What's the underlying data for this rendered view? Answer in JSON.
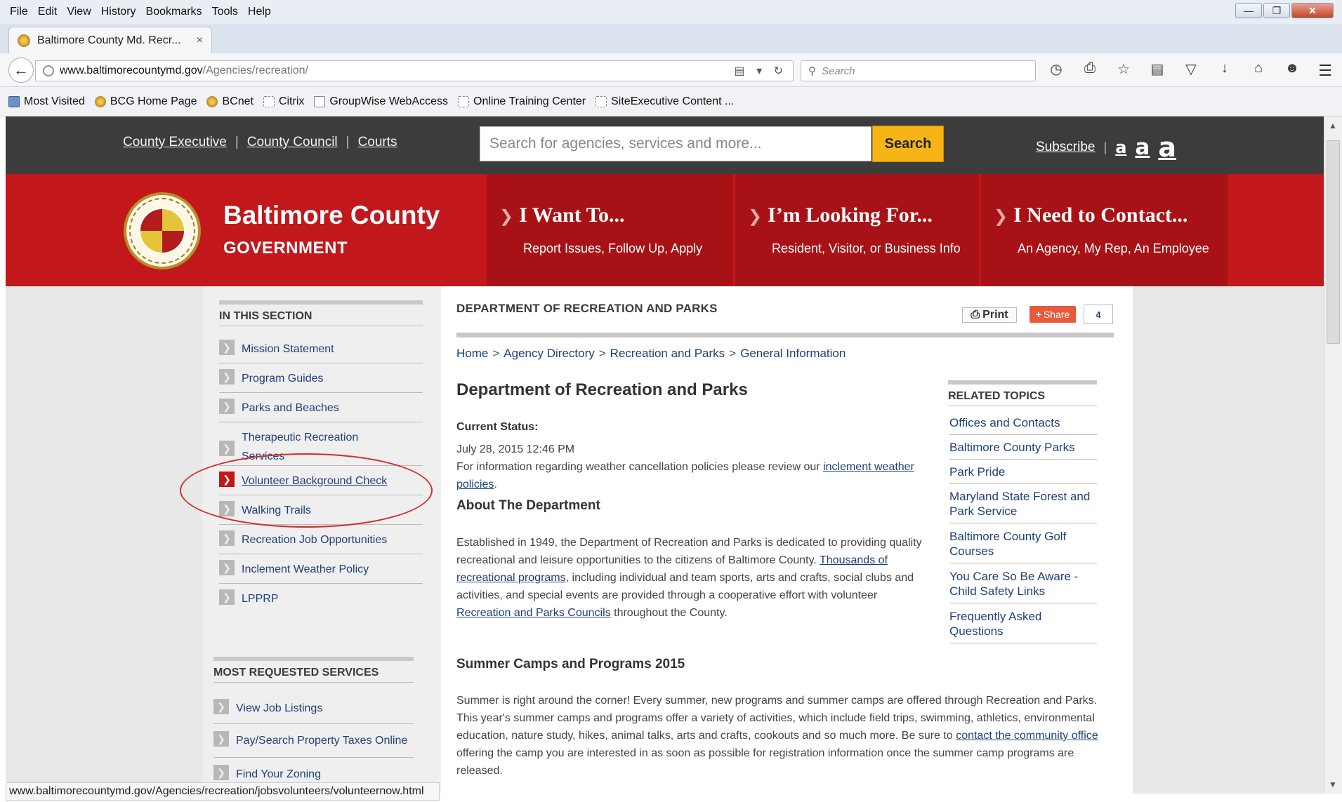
{
  "browser": {
    "menu": [
      "File",
      "Edit",
      "View",
      "History",
      "Bookmarks",
      "Tools",
      "Help"
    ],
    "tab_title": "Baltimore County Md. Recr...",
    "tab_close": "×",
    "new_tab": "+",
    "url_host": "www.baltimorecountymd.gov",
    "url_path": "/Agencies/recreation/",
    "search_placeholder": "Search",
    "bookmarks": [
      "Most Visited",
      "BCG Home Page",
      "BCnet",
      "Citrix",
      "GroupWise WebAccess",
      "Online Training Center",
      "SiteExecutive Content ..."
    ],
    "status_url": "www.baltimorecountymd.gov/Agencies/recreation/jobsvolunteers/volunteernow.html",
    "icons": [
      "history-icon",
      "print-icon",
      "bookmark-star-icon",
      "reader-list-icon",
      "pocket-icon",
      "download-icon",
      "home-icon",
      "chat-icon"
    ]
  },
  "site": {
    "top_links": [
      "County Executive",
      "County Council",
      "Courts"
    ],
    "search_placeholder": "Search for agencies, services and more...",
    "search_button": "Search",
    "subscribe": "Subscribe",
    "font_sizes": [
      "a",
      "a",
      "a"
    ],
    "brand_line1": "Baltimore County",
    "brand_line2": "GOVERNMENT",
    "nav": [
      {
        "title": "I Want To...",
        "sub": "Report Issues, Follow Up, Apply"
      },
      {
        "title": "I’m Looking For...",
        "sub": "Resident, Visitor, or Business Info"
      },
      {
        "title": "I Need to Contact...",
        "sub": "An Agency, My Rep, An Employee"
      }
    ],
    "colors": {
      "brand_red": "#c2171b",
      "panel_red": "#a81216",
      "search_yellow": "#f6b417",
      "link_blue": "#1f3f7a"
    }
  },
  "sidebar": {
    "section_title": "IN THIS SECTION",
    "items": [
      "Mission Statement",
      "Program Guides",
      "Parks and Beaches",
      "Therapeutic Recreation Services",
      "Volunteer Background Check",
      "Walking Trails",
      "Recreation Job Opportunities",
      "Inclement Weather Policy",
      "LPPRP"
    ],
    "active_item": "Volunteer Background Check",
    "services_title": "MOST REQUESTED SERVICES",
    "services": [
      "View Job Listings",
      "Pay/Search Property Taxes Online",
      "Find Your Zoning"
    ]
  },
  "main": {
    "dept_header": "DEPARTMENT OF RECREATION AND PARKS",
    "print": "Print",
    "share": "Share",
    "share_count": "4",
    "breadcrumb": [
      "Home",
      "Agency Directory",
      "Recreation and Parks",
      "General Information"
    ],
    "breadcrumb_sep": ">",
    "title": "Department of Recreation and Parks",
    "status_label": "Current Status:",
    "status_date": "July 28, 2015 12:46 PM",
    "weather_text": "For information regarding weather cancellation policies please review our",
    "weather_link": "inclement weather policies",
    "about_heading": "About The Department",
    "about_1": "Established in 1949, the Department of Recreation and Parks is dedicated to providing quality recreational and leisure opportunities to the citizens of Baltimore County.",
    "about_link1": "Thousands of recreational programs",
    "about_2": ", including individual and team sports, arts and crafts, social clubs and activities, and special events are provided through a cooperative effort with volunteer",
    "about_link2": "Recreation and Parks Councils",
    "about_3": "throughout the County.",
    "summer_heading": "Summer Camps and Programs 2015",
    "summer_1": "Summer is right around the corner! Every summer, new programs and summer camps are offered through Recreation and Parks. This year's summer camps and programs offer a variety of activities, which include field trips, swimming, athletics, environmental education, nature study, hikes, animal talks, arts and crafts, cookouts and so much more. Be sure to",
    "summer_link": "contact the community office",
    "summer_2": "offering the camp you are interested in as soon as possible for registration information once the summer camp programs are released.",
    "related_title": "RELATED TOPICS",
    "related": [
      "Offices and Contacts",
      "Baltimore County Parks",
      "Park Pride",
      "Maryland State Forest and Park Service",
      "Baltimore County Golf Courses",
      "You Care So Be Aware - Child Safety Links",
      "Frequently Asked Questions"
    ]
  }
}
